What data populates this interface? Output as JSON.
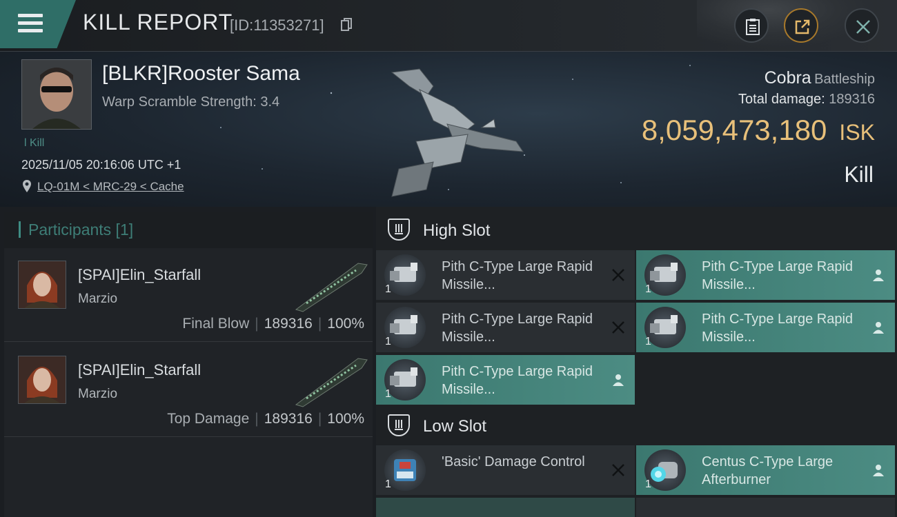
{
  "topbar": {
    "title": "KILL REPORT",
    "report_id": "[ID:11353271]",
    "icons": [
      "menu-icon",
      "copy-icon",
      "clipboard-icon",
      "share-icon",
      "close-icon"
    ]
  },
  "victim": {
    "name": "[BLKR]Rooster Sama",
    "warp_scramble": "Warp Scramble Strength: 3.4",
    "kill_count": "l Kill",
    "datetime": "2025/11/05 20:16:06 UTC +1",
    "location": "LQ-01M < MRC-29 < Cache"
  },
  "ship": {
    "name": "Cobra",
    "class": "Battleship",
    "total_damage_label": "Total damage:",
    "total_damage_value": "189316",
    "isk_value": "8,059,473,180",
    "isk_unit": "ISK",
    "outcome": "Kill"
  },
  "participants": {
    "title": "Participants [1]",
    "list": [
      {
        "name": "[SPAI]Elin_Starfall",
        "corp": "Marzio",
        "role": "Final Blow",
        "damage": "189316",
        "percent": "100%"
      },
      {
        "name": "[SPAI]Elin_Starfall",
        "corp": "Marzio",
        "role": "Top Damage",
        "damage": "189316",
        "percent": "100%"
      }
    ]
  },
  "fitting": {
    "high_slot": {
      "title": "High Slot",
      "modules": [
        {
          "name": "Pith C-Type Large Rapid Missile...",
          "qty": "1",
          "state": "destroyed"
        },
        {
          "name": "Pith C-Type Large Rapid Missile...",
          "qty": "1",
          "state": "dropped"
        },
        {
          "name": "Pith C-Type Large Rapid Missile...",
          "qty": "1",
          "state": "destroyed"
        },
        {
          "name": "Pith C-Type Large Rapid Missile...",
          "qty": "1",
          "state": "dropped"
        },
        {
          "name": "Pith C-Type Large Rapid Missile...",
          "qty": "1",
          "state": "dropped"
        }
      ]
    },
    "low_slot": {
      "title": "Low Slot",
      "modules": [
        {
          "name": "'Basic' Damage Control",
          "qty": "1",
          "state": "destroyed"
        },
        {
          "name": "Centus C-Type Large Afterburner",
          "qty": "1",
          "state": "dropped"
        }
      ]
    }
  },
  "colors": {
    "accent_teal": "#3f8c83",
    "isk_gold": "#e8c07a",
    "dropped_bg": "#4c8c83",
    "destroyed_bg": "#2a2e32"
  }
}
